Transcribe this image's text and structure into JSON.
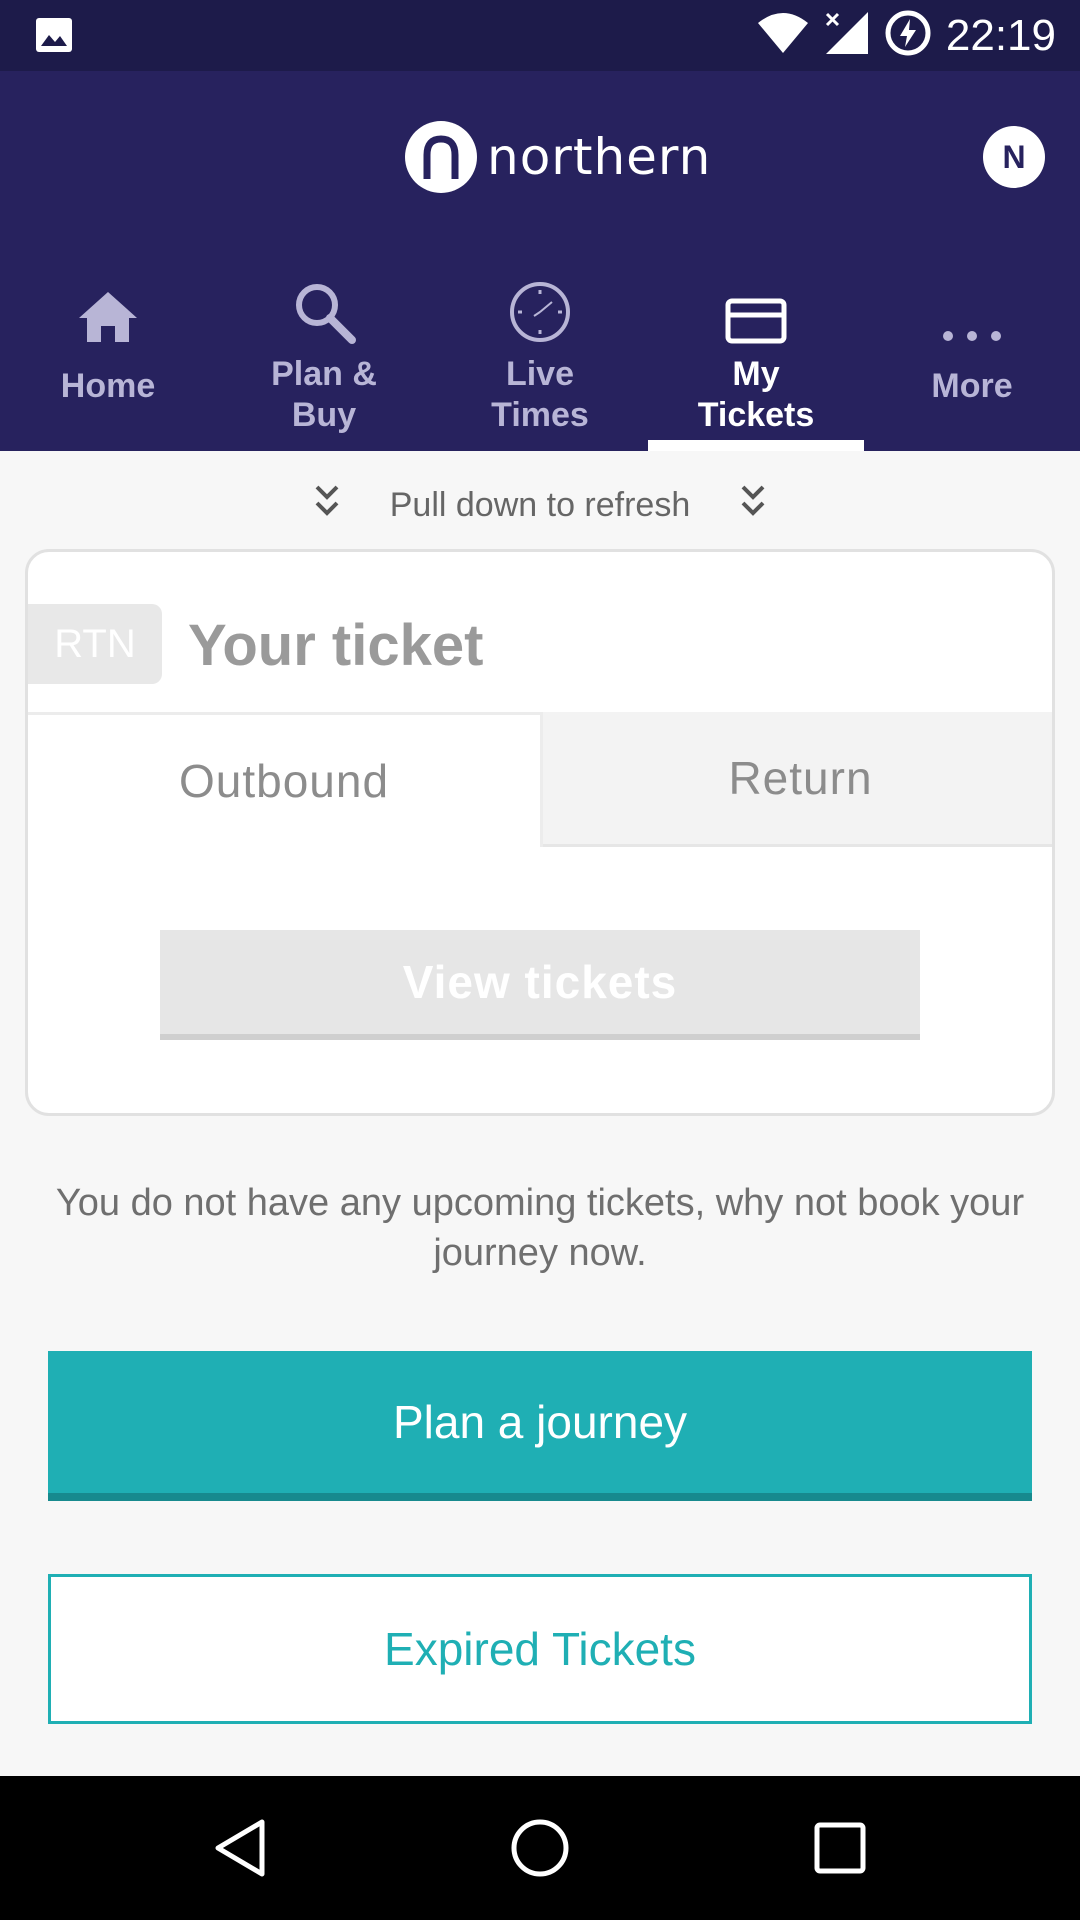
{
  "status_bar": {
    "time": "22:19",
    "icons": [
      "gallery-icon",
      "wifi-icon",
      "signal-icon",
      "battery-charging-icon"
    ]
  },
  "header": {
    "logo_text": "northern",
    "avatar_initial": "N"
  },
  "nav": {
    "items": [
      {
        "label": "Home",
        "icon": "home-icon"
      },
      {
        "label": "Plan &\nBuy",
        "icon": "search-icon"
      },
      {
        "label": "Live\nTimes",
        "icon": "clock-icon"
      },
      {
        "label": "My\nTickets",
        "icon": "ticket-icon",
        "active": true
      },
      {
        "label": "More",
        "icon": "more-icon"
      }
    ]
  },
  "refresh": {
    "text": "Pull down to refresh"
  },
  "ticket_card": {
    "badge": "RTN",
    "title": "Your ticket",
    "tabs": [
      "Outbound",
      "Return"
    ],
    "active_tab": "Outbound",
    "view_button": "View tickets"
  },
  "empty_message": "You do not have any upcoming tickets, why not book your journey now.",
  "buttons": {
    "plan": "Plan a journey",
    "expired": "Expired Tickets"
  },
  "colors": {
    "header": "#27225e",
    "status_bar": "#1d1b4a",
    "accent": "#1fafb4"
  }
}
